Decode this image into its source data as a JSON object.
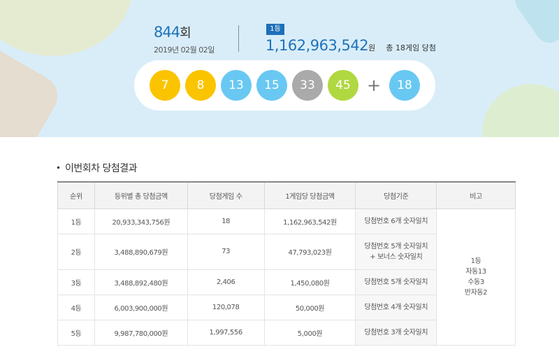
{
  "draw": {
    "round_number": "844",
    "round_suffix": "회",
    "date": "2019년 02월 02일",
    "rank_badge": "1등",
    "first_prize_amount": "1,162,963,542",
    "first_prize_unit": "원",
    "first_prize_games": "총 18게임 당첨"
  },
  "numbers": [
    {
      "value": "7",
      "color": "#fbc400"
    },
    {
      "value": "8",
      "color": "#fbc400"
    },
    {
      "value": "13",
      "color": "#69c8f2"
    },
    {
      "value": "15",
      "color": "#69c8f2"
    },
    {
      "value": "33",
      "color": "#aaaaaa"
    },
    {
      "value": "45",
      "color": "#b0d840"
    }
  ],
  "plus_sign": "+",
  "bonus": {
    "value": "18",
    "color": "#69c8f2"
  },
  "results": {
    "title": "이번회차 당첨결과",
    "headers": [
      "순위",
      "등위별 총 당첨금액",
      "당첨게임 수",
      "1게임당 당첨금액",
      "당첨기준",
      "비고"
    ],
    "rows": [
      {
        "rank": "1등",
        "total": "20,933,343,756원",
        "games": "18",
        "per_game": "1,162,963,542원",
        "criteria": [
          "당첨번호 6개 숫자일치"
        ]
      },
      {
        "rank": "2등",
        "total": "3,488,890,679원",
        "games": "73",
        "per_game": "47,793,023원",
        "criteria": [
          "당첨번호 5개 숫자일치",
          "+ 보너스 숫자일치"
        ]
      },
      {
        "rank": "3등",
        "total": "3,488,892,480원",
        "games": "2,406",
        "per_game": "1,450,080원",
        "criteria": [
          "당첨번호 5개 숫자일치"
        ]
      },
      {
        "rank": "4등",
        "total": "6,003,900,000원",
        "games": "120,078",
        "per_game": "50,000원",
        "criteria": [
          "당첨번호 4개 숫자일치"
        ]
      },
      {
        "rank": "5등",
        "total": "9,987,780,000원",
        "games": "1,997,556",
        "per_game": "5,000원",
        "criteria": [
          "당첨번호 3개 숫자일치"
        ]
      }
    ],
    "note": [
      "1등",
      "자동13",
      "수동3",
      "반자동2"
    ]
  }
}
